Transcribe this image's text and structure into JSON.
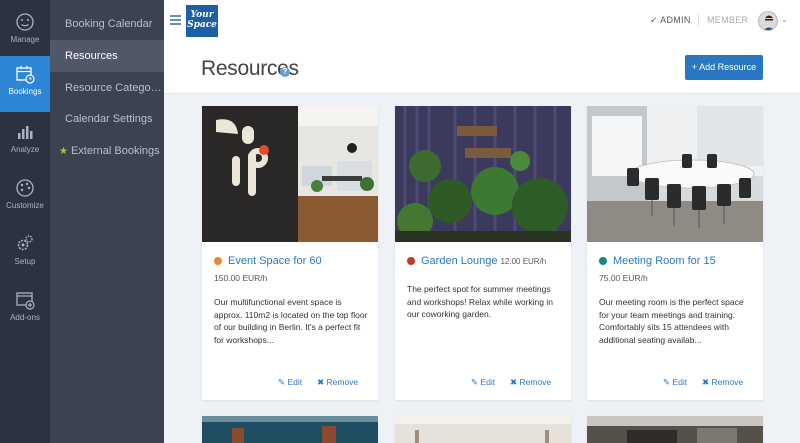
{
  "rail": [
    {
      "label": "Manage",
      "icon": "face-icon"
    },
    {
      "label": "Bookings",
      "icon": "calendar-icon"
    },
    {
      "label": "Analyze",
      "icon": "bar-chart-icon"
    },
    {
      "label": "Customize",
      "icon": "palette-icon"
    },
    {
      "label": "Setup",
      "icon": "gears-icon"
    },
    {
      "label": "Add-ons",
      "icon": "add-window-icon"
    }
  ],
  "menu": [
    {
      "label": "Booking Calendar"
    },
    {
      "label": "Resources"
    },
    {
      "label": "Resource Categori..."
    },
    {
      "label": "Calendar Settings"
    },
    {
      "label": "External Bookings"
    }
  ],
  "header": {
    "logo_line1": "Your",
    "logo_line2": "Space",
    "admin": "ADMIN",
    "member": "MEMBER"
  },
  "page": {
    "title": "Resources",
    "help": "?",
    "add_button": "Add Resource"
  },
  "cards": [
    {
      "name": "Event Space for 60",
      "price": "150.00 EUR/h",
      "dot_color": "#f0852d",
      "desc": "Our multifunctional event space is approx. 110m2 is located on the top floor of our building in Berlin. It's a perfect fit for workshops...",
      "edit": "Edit",
      "remove": "Remove"
    },
    {
      "name": "Garden Lounge",
      "price": "12.00 EUR/h",
      "dot_color": "#c0392b",
      "desc": "The perfect spot for summer meetings and workshops! Relax while working in our coworking garden.",
      "edit": "Edit",
      "remove": "Remove"
    },
    {
      "name": "Meeting Room for 15",
      "price": "75.00 EUR/h",
      "dot_color": "#138a7f",
      "desc": "Our meeting room is the perfect space for your team meetings and training. Comfortably sits 15 attendees with additional seating availab...",
      "edit": "Edit",
      "remove": "Remove"
    }
  ],
  "colors": {
    "accent": "#2a78c4",
    "rail_bg": "#2c3340",
    "menu_bg": "#3b4250"
  }
}
